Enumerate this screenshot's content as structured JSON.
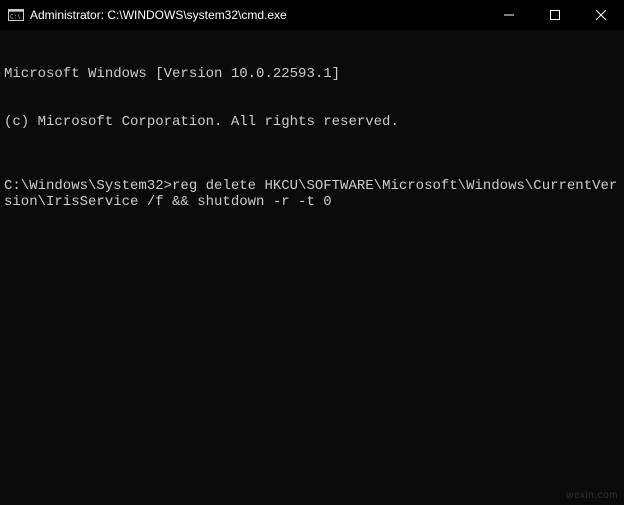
{
  "window": {
    "title": "Administrator: C:\\WINDOWS\\system32\\cmd.exe"
  },
  "terminal": {
    "banner_line1": "Microsoft Windows [Version 10.0.22593.1]",
    "banner_line2": "(c) Microsoft Corporation. All rights reserved.",
    "prompt": "C:\\Windows\\System32>",
    "command": "reg delete HKCU\\SOFTWARE\\Microsoft\\Windows\\CurrentVersion\\IrisService /f && shutdown -r -t 0"
  },
  "watermark": "wexin.com"
}
